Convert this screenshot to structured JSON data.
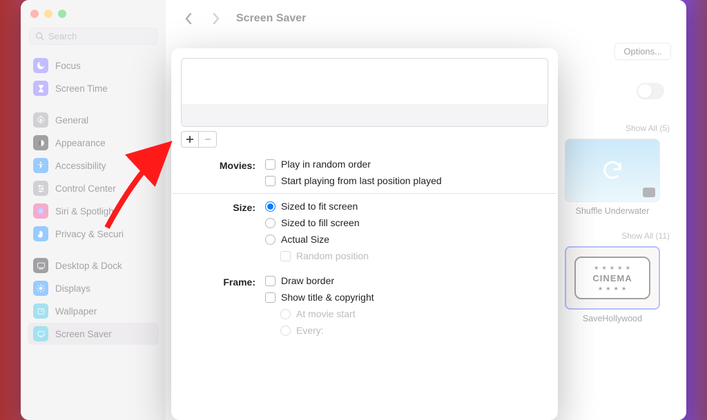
{
  "window": {
    "title": "Screen Saver"
  },
  "search": {
    "placeholder": "Search"
  },
  "sidebar": {
    "groups": [
      [
        {
          "label": "Focus",
          "color": "#7b6cff",
          "glyph": "moon"
        },
        {
          "label": "Screen Time",
          "color": "#7b6cff",
          "glyph": "hourglass"
        }
      ],
      [
        {
          "label": "General",
          "color": "#9a9aa2",
          "glyph": "gear"
        },
        {
          "label": "Appearance",
          "color": "#2f2f33",
          "glyph": "appearance"
        },
        {
          "label": "Accessibility",
          "color": "#1e8cff",
          "glyph": "accessibility"
        },
        {
          "label": "Control Center",
          "color": "#9a9aa2",
          "glyph": "sliders"
        },
        {
          "label": "Siri & Spotlight",
          "color": "#e64b8a",
          "glyph": "siri"
        },
        {
          "label": "Privacy & Security",
          "color": "#1e8cff",
          "glyph": "hand",
          "truncated": "Privacy & Securi"
        }
      ],
      [
        {
          "label": "Desktop & Dock",
          "color": "#2f2f33",
          "glyph": "dock",
          "truncated": "Desktop & Dock"
        },
        {
          "label": "Displays",
          "color": "#1e8cff",
          "glyph": "sun"
        },
        {
          "label": "Wallpaper",
          "color": "#34bde0",
          "glyph": "wallpaper"
        },
        {
          "label": "Screen Saver",
          "color": "#34bde0",
          "glyph": "screensaver",
          "selected": true
        }
      ]
    ]
  },
  "options_button": "Options...",
  "right": {
    "showall1": "Show All (5)",
    "thumb1_label": "Shuffle Underwater",
    "showall2": "Show All (11)",
    "thumb2_label": "SaveHollywood",
    "cinema_word": "CINEMA"
  },
  "sheet": {
    "sections": {
      "movies": {
        "label": "Movies:",
        "opts": [
          {
            "kind": "chk",
            "text": "Play in random order"
          },
          {
            "kind": "chk",
            "text": "Start playing from last position played"
          }
        ]
      },
      "size": {
        "label": "Size:",
        "opts": [
          {
            "kind": "rdo",
            "text": "Sized to fit screen",
            "sel": true
          },
          {
            "kind": "rdo",
            "text": "Sized to fill screen"
          },
          {
            "kind": "rdo",
            "text": "Actual Size"
          },
          {
            "kind": "chk",
            "text": "Random position",
            "disabled": true,
            "sub": true
          }
        ]
      },
      "frame": {
        "label": "Frame:",
        "opts": [
          {
            "kind": "chk",
            "text": "Draw border"
          },
          {
            "kind": "chk",
            "text": "Show title & copyright"
          },
          {
            "kind": "rdo",
            "text": "At movie start",
            "disabled": true,
            "sub": true
          },
          {
            "kind": "rdo",
            "text": "Every:",
            "disabled": true,
            "sub": true
          }
        ]
      }
    }
  }
}
